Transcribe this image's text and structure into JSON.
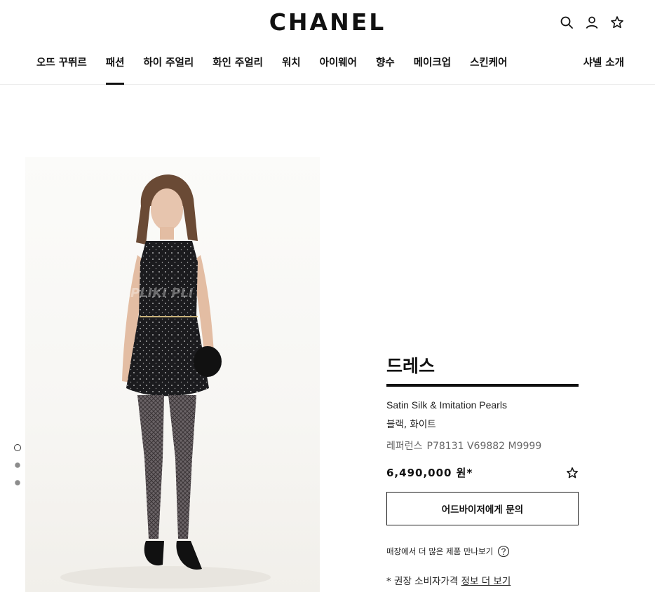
{
  "brand": {
    "logo_text": "CHANEL"
  },
  "header_icons": [
    "search-icon",
    "account-icon",
    "wishlist-star-icon"
  ],
  "nav": {
    "items": [
      {
        "label": "오뜨 꾸뛰르",
        "active": false
      },
      {
        "label": "패션",
        "active": true
      },
      {
        "label": "하이 주얼리",
        "active": false
      },
      {
        "label": "화인 주얼리",
        "active": false
      },
      {
        "label": "워치",
        "active": false
      },
      {
        "label": "아이웨어",
        "active": false
      },
      {
        "label": "향수",
        "active": false
      },
      {
        "label": "메이크업",
        "active": false
      },
      {
        "label": "스킨케어",
        "active": false
      }
    ],
    "right_label": "샤넬 소개"
  },
  "gallery": {
    "slides": 3,
    "active_slide": 1,
    "watermark": "PLIKI  PLI"
  },
  "product": {
    "title": "드레스",
    "material": "Satin Silk & Imitation Pearls",
    "color": "블랙, 화이트",
    "ref_label": "레퍼런스",
    "ref_code": "P78131 V69882 M9999",
    "price": "6,490,000 원*",
    "cta_label": "어드바이저에게 문의",
    "store_link_label": "매장에서 더 많은 제품 만나보기",
    "note_prefix": "* 권장 소비자가격 ",
    "note_link": "정보 더 보기"
  },
  "colors": {
    "text": "#111111",
    "border": "#1d1d1d",
    "muted": "#666666",
    "background": "#ffffff"
  }
}
